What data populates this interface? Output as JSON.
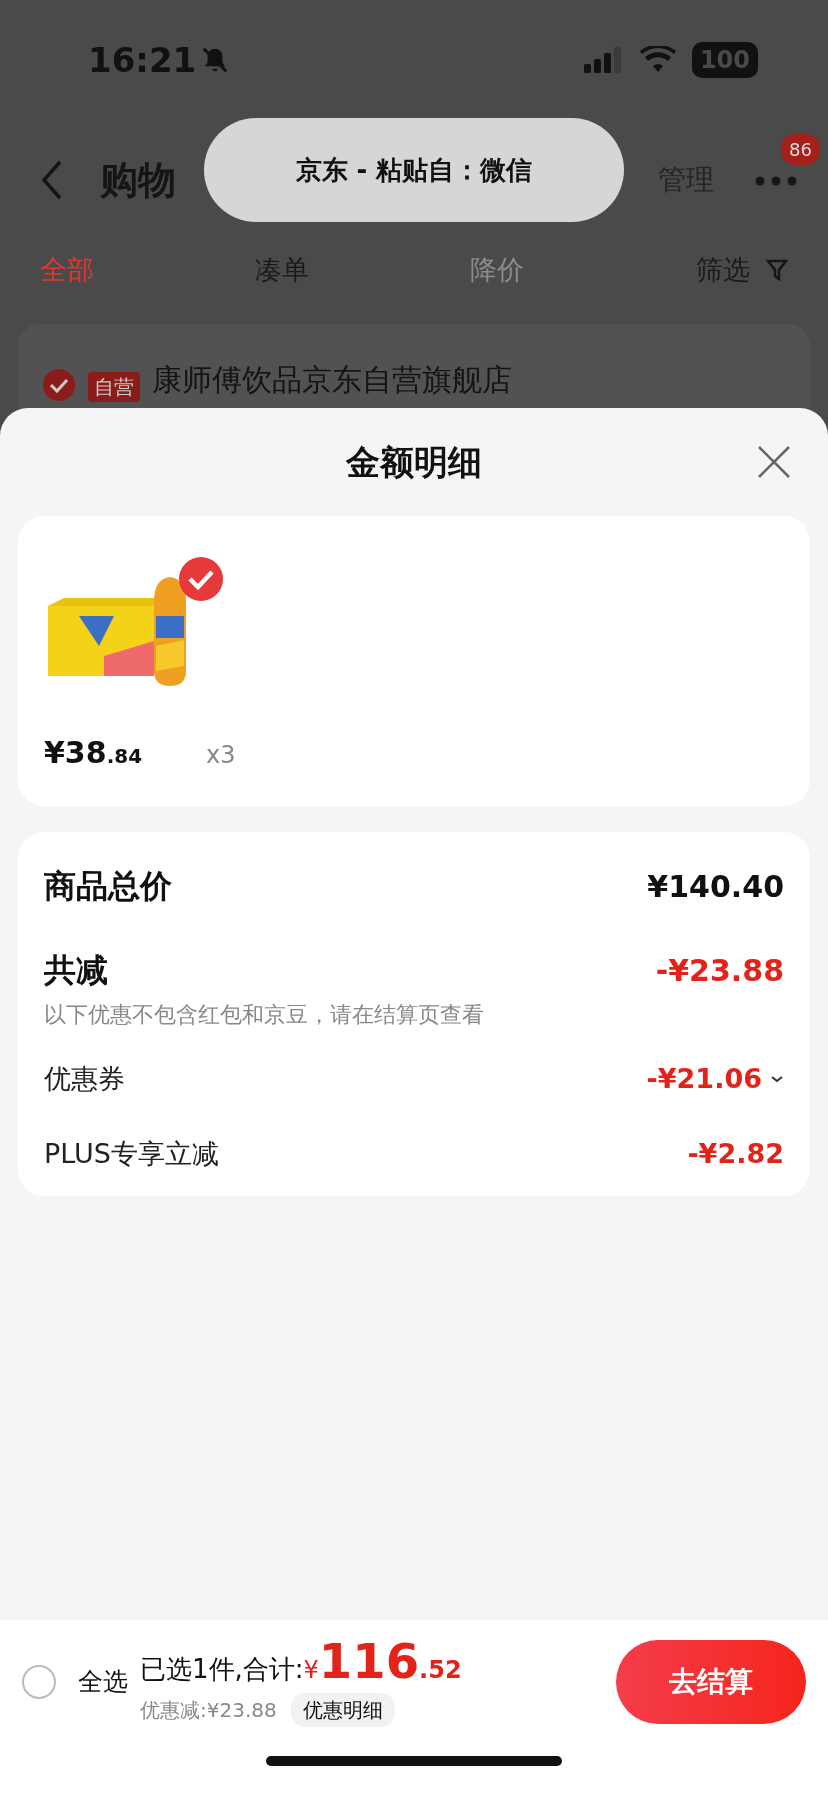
{
  "status_bar": {
    "time": "16:21",
    "battery": "100"
  },
  "header": {
    "title": "购物",
    "actions": [
      "管理"
    ],
    "badge": "86"
  },
  "tabs": [
    {
      "label": "全部",
      "selected": true,
      "disabled": false
    },
    {
      "label": "凑单",
      "selected": false,
      "disabled": false
    },
    {
      "label": "降价",
      "selected": false,
      "disabled": true
    }
  ],
  "filter": "筛选",
  "toast": "京东 - 粘贴自：微信",
  "store": {
    "tag": "自营",
    "name": "康师傅饮品京东自营旗舰店"
  },
  "sheet": {
    "title": "金额明细",
    "items": [
      {
        "kind": "picture",
        "selected": true,
        "price_main": "¥38",
        "price_cents": ".84",
        "quantity": "x3"
      }
    ],
    "summary": [
      {
        "kind": "total",
        "label": "商品总价",
        "value": "¥140.40"
      },
      {
        "kind": "discount",
        "label": "共减",
        "value": "-¥23.88",
        "note": "以下优惠不包含红包和京豆，请在结算页查看"
      },
      {
        "kind": "item",
        "label": "优惠券",
        "value": "-¥21.06",
        "expandable": true
      },
      {
        "kind": "item",
        "label": "PLUS专享立减",
        "value": "-¥2.82",
        "expandable": false
      }
    ]
  },
  "bottom_bar": {
    "select_all": {
      "label": "全选",
      "checked": false
    },
    "selected_text": "已选1件,合计:",
    "currency": "¥",
    "total_main": "116",
    "total_cents": ".52",
    "saving": "优惠减:¥23.88",
    "detail_button": "优惠明细",
    "checkout": "去结算"
  }
}
